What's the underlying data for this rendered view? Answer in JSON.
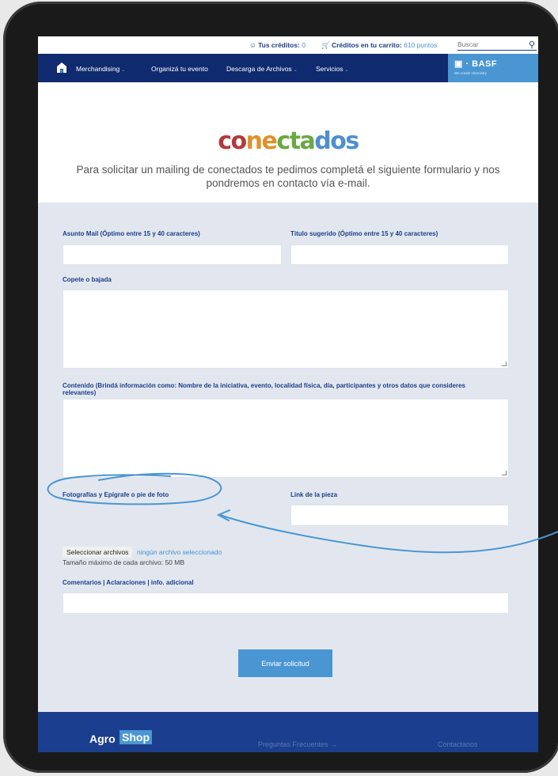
{
  "utility_bar": {
    "credits_label": "Tus créditos:",
    "credits_value": "0",
    "cart_label": "Créditos en tu carrito:",
    "cart_value": "610 puntos",
    "search_placeholder": "Buscar"
  },
  "nav": {
    "items": [
      {
        "label": "Merchandising"
      },
      {
        "label": "Organizá tu evento"
      },
      {
        "label": "Descarga de Archivos"
      },
      {
        "label": "Servicios"
      }
    ],
    "brand": "BASF",
    "brand_tagline": "We create chemistry"
  },
  "hero": {
    "logo_letters": [
      {
        "ch": "c",
        "color": "#b33a3a"
      },
      {
        "ch": "o",
        "color": "#b33a3a"
      },
      {
        "ch": "n",
        "color": "#e0912b"
      },
      {
        "ch": "e",
        "color": "#e0912b"
      },
      {
        "ch": "c",
        "color": "#6aa842"
      },
      {
        "ch": "t",
        "color": "#6aa842"
      },
      {
        "ch": "a",
        "color": "#6aa842"
      },
      {
        "ch": "d",
        "color": "#4f8fd0"
      },
      {
        "ch": "o",
        "color": "#4f8fd0"
      },
      {
        "ch": "s",
        "color": "#4f8fd0"
      }
    ],
    "intro": "Para solicitar un mailing de conectados te pedimos completá el siguiente formulario y nos pondremos en contacto vía e-mail."
  },
  "form": {
    "asunto_label": "Asunto Mail (Óptimo entre 15 y 40 caracteres)",
    "titulo_label": "Título sugerido (Óptimo entre 15 y 40 caracteres)",
    "copete_label": "Copete o bajada",
    "contenido_label": "Contenido (Brindá información como: Nombre de la iniciativa, evento, localidad física, día, participantes y otros datos que consideres relevantes)",
    "fotos_label": "Fotografías y Epígrafe o pie de foto",
    "link_label": "Link de la pieza",
    "file_button": "Seleccionar archivos",
    "file_status": "ningún archivo seleccionado",
    "file_size": "Tamaño máximo de cada archivo: 50 MB",
    "comentarios_label": "Comentarios | Aclaraciones | info. adicional",
    "submit_label": "Enviar solicitud"
  },
  "footer": {
    "brand_part1": "Agro",
    "brand_part2": "Shop",
    "faq": "Preguntas Frecuentes",
    "contact": "Contactanos"
  },
  "colors": {
    "navy": "#0f2a6e",
    "accent": "#4a96d2",
    "annotation": "#4a96d2"
  }
}
